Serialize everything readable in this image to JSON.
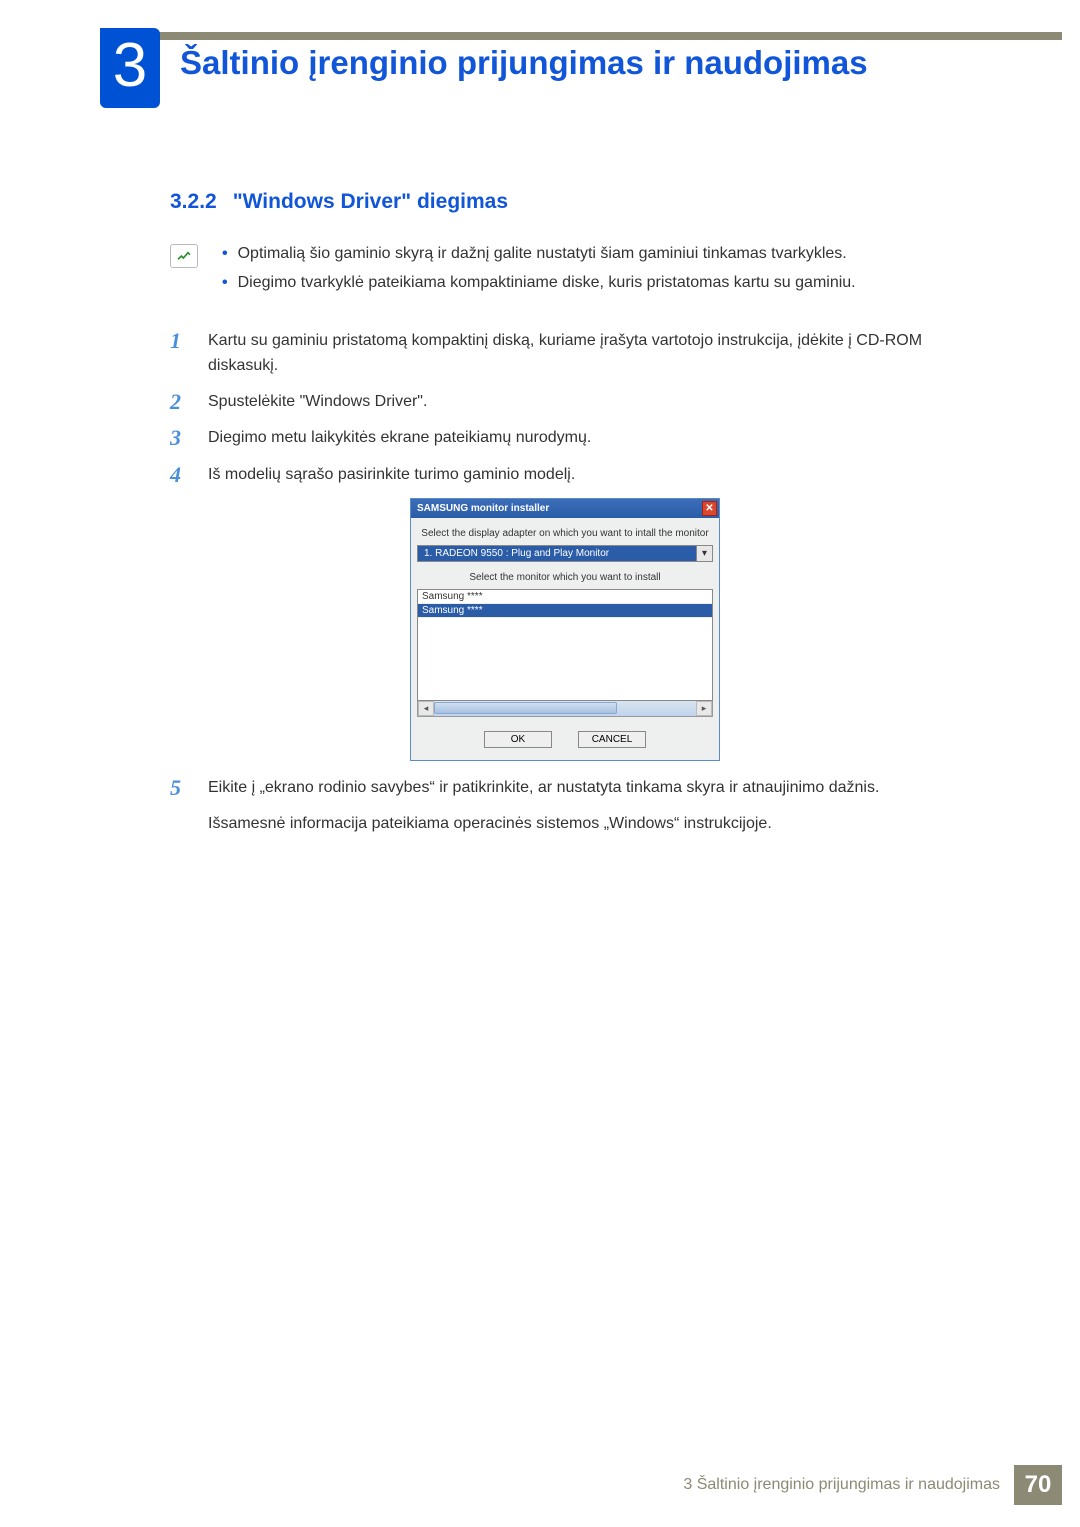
{
  "chapter": {
    "number": "3",
    "title": "Šaltinio įrenginio prijungimas ir naudojimas"
  },
  "section": {
    "number": "3.2.2",
    "title": "\"Windows Driver\" diegimas"
  },
  "notes": [
    "Optimalią šio gaminio skyrą ir dažnį galite nustatyti šiam gaminiui tinkamas tvarkykles.",
    "Diegimo tvarkyklė pateikiama kompaktiniame diske, kuris pristatomas kartu su gaminiu."
  ],
  "steps": [
    {
      "n": "1",
      "text": "Kartu su gaminiu pristatomą kompaktinį diską, kuriame įrašyta vartotojo instrukcija, įdėkite į CD-ROM diskasukį."
    },
    {
      "n": "2",
      "text": "Spustelėkite \"Windows Driver\"."
    },
    {
      "n": "3",
      "text": "Diegimo metu laikykitės ekrane pateikiamų nurodymų."
    },
    {
      "n": "4",
      "text": "Iš modelių sąrašo pasirinkite turimo gaminio modelį."
    }
  ],
  "installer": {
    "title": "SAMSUNG monitor installer",
    "label1": "Select the display adapter on which you want to intall the monitor",
    "adapter": "1. RADEON 9550 : Plug and Play Monitor",
    "label2": "Select the monitor which you want to install",
    "monitors": [
      "Samsung ****",
      "Samsung ****"
    ],
    "ok": "OK",
    "cancel": "CANCEL"
  },
  "step5": {
    "n": "5",
    "text": "Eikite į „ekrano rodinio savybes“ ir patikrinkite, ar nustatyta tinkama skyra ir atnaujinimo dažnis.",
    "subtext": "Išsamesnė informacija pateikiama operacinės sistemos „Windows“ instrukcijoje."
  },
  "footer": {
    "text": "3 Šaltinio įrenginio prijungimas ir naudojimas",
    "page": "70"
  }
}
